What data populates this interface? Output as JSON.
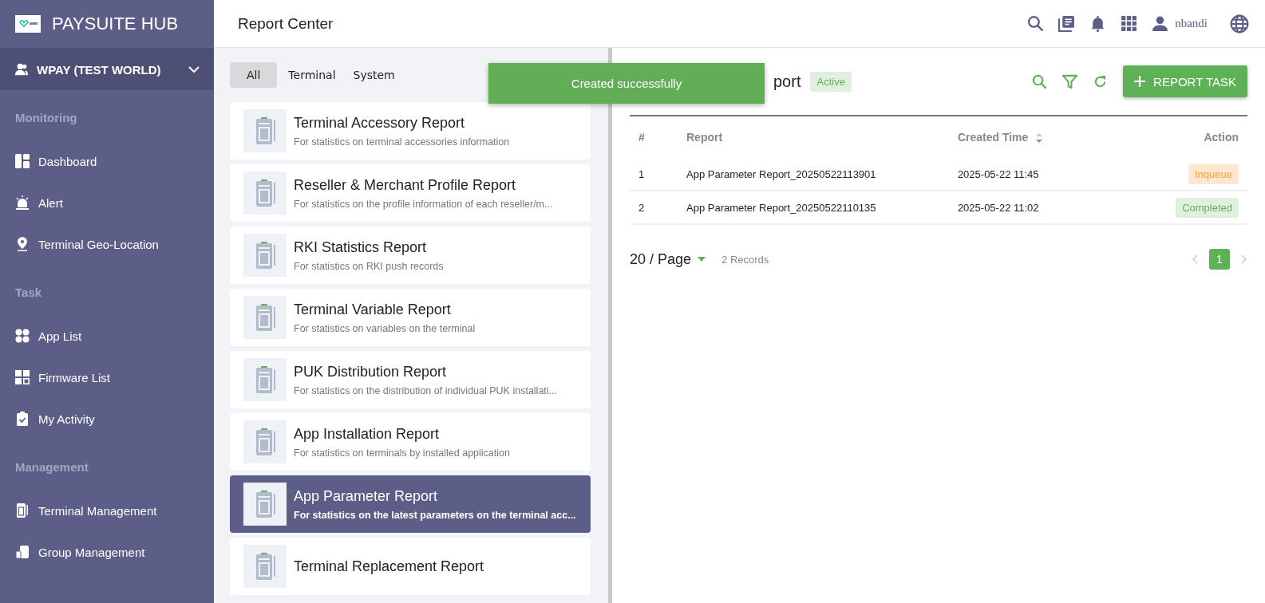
{
  "brand": {
    "title": "PAYSUITE HUB"
  },
  "org_selector": {
    "label": "WPAY (TEST WORLD)"
  },
  "sidebar": {
    "sections": [
      {
        "heading": "Monitoring",
        "items": [
          {
            "label": "Dashboard",
            "kind": "dashboard"
          },
          {
            "label": "Alert",
            "kind": "alert"
          },
          {
            "label": "Terminal Geo-Location",
            "kind": "pin"
          }
        ]
      },
      {
        "heading": "Task",
        "items": [
          {
            "label": "App List",
            "kind": "apps"
          },
          {
            "label": "Firmware List",
            "kind": "firmware"
          },
          {
            "label": "My Activity",
            "kind": "clipboard"
          }
        ]
      },
      {
        "heading": "Management",
        "items": [
          {
            "label": "Terminal Management",
            "kind": "terminal"
          },
          {
            "label": "Group Management",
            "kind": "group"
          }
        ]
      }
    ]
  },
  "header": {
    "title": "Report Center",
    "user": "nbandi"
  },
  "filter_tabs": [
    {
      "label": "All",
      "selected": true
    },
    {
      "label": "Terminal",
      "selected": false
    },
    {
      "label": "System",
      "selected": false
    }
  ],
  "reports": [
    {
      "title": "Terminal Accessory Report",
      "description": "For statistics on terminal accessories information",
      "selected": false
    },
    {
      "title": "Reseller & Merchant Profile Report",
      "description": "For statistics on the profile information of each reseller/m...",
      "selected": false
    },
    {
      "title": "RKI Statistics Report",
      "description": "For statistics on RKI push records",
      "selected": false
    },
    {
      "title": "Terminal Variable Report",
      "description": "For statistics on variables on the terminal",
      "selected": false
    },
    {
      "title": "PUK Distribution Report",
      "description": "For statistics on the distribution of individual PUK installati...",
      "selected": false
    },
    {
      "title": "App Installation Report",
      "description": "For statistics on terminals by installed application",
      "selected": false
    },
    {
      "title": "App Parameter Report",
      "description": "For statistics on the latest parameters on the terminal acc...",
      "selected": true
    },
    {
      "title": "Terminal Replacement Report",
      "selected": false
    }
  ],
  "toast": {
    "message": "Created successfully"
  },
  "detail": {
    "title": "port",
    "status": "Active",
    "add_button": "REPORT TASK",
    "table": {
      "columns": [
        "#",
        "Report",
        "Created Time",
        "Action"
      ],
      "rows": [
        {
          "index": "1",
          "report": "App Parameter Report_20250522113901",
          "created": "2025-05-22 11:45",
          "status": "Inqueue",
          "kind": "queued"
        },
        {
          "index": "2",
          "report": "App Parameter Report_20250522110135",
          "created": "2025-05-22 11:02",
          "status": "Completed",
          "kind": "done"
        }
      ]
    },
    "page_size": "20 / Page",
    "records": "2 Records",
    "pages": [
      {
        "label": "1",
        "selected": true
      }
    ]
  }
}
